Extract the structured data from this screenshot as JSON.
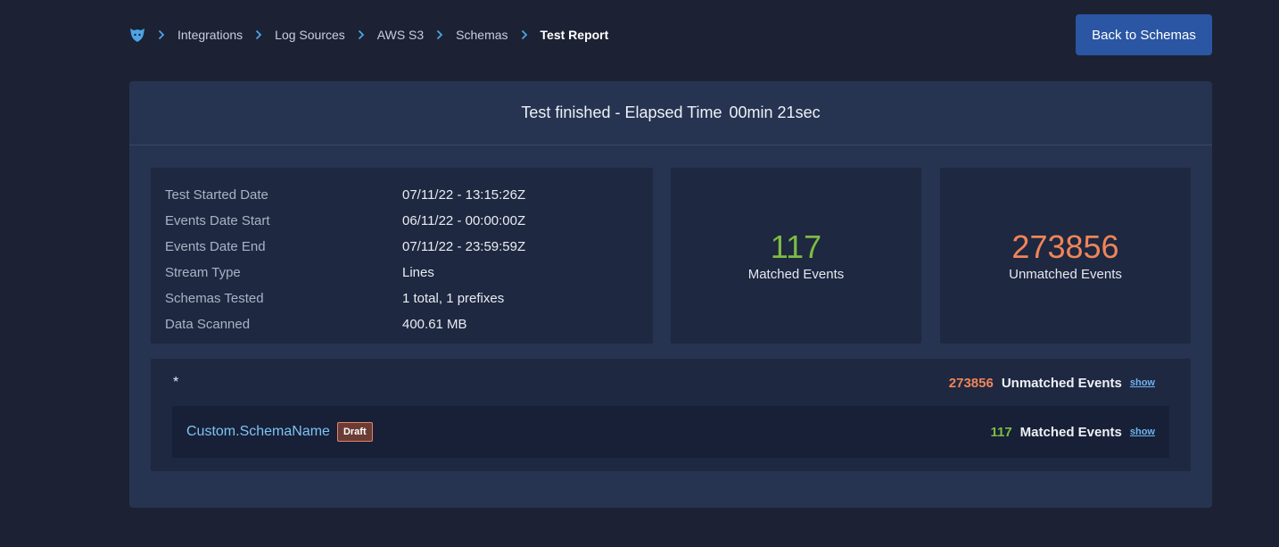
{
  "breadcrumb": {
    "logo_icon": "panther-logo-icon",
    "items": [
      "Integrations",
      "Log Sources",
      "AWS S3",
      "Schemas"
    ],
    "current": "Test Report"
  },
  "header": {
    "back_button_label": "Back to Schemas"
  },
  "report": {
    "status_text": "Test finished - Elapsed Time",
    "elapsed": "00min 21sec",
    "details": [
      {
        "label": "Test Started Date",
        "value": "07/11/22 - 13:15:26Z"
      },
      {
        "label": "Events Date Start",
        "value": "06/11/22 - 00:00:00Z"
      },
      {
        "label": "Events Date End",
        "value": "07/11/22 - 23:59:59Z"
      },
      {
        "label": "Stream Type",
        "value": "Lines"
      },
      {
        "label": "Schemas Tested",
        "value": "1 total, 1 prefixes"
      },
      {
        "label": "Data Scanned",
        "value": "400.61 MB"
      }
    ],
    "matched": {
      "count": "117",
      "label": "Matched Events"
    },
    "unmatched": {
      "count": "273856",
      "label": "Unmatched Events"
    }
  },
  "prefix": {
    "name": "*",
    "unmatched_count": "273856",
    "unmatched_label": "Unmatched Events",
    "show_label": "show",
    "schema": {
      "name": "Custom.SchemaName",
      "badge": "Draft",
      "matched_count": "117",
      "matched_label": "Matched Events",
      "show_label": "show"
    }
  },
  "colors": {
    "matched": "#7dbb42",
    "unmatched": "#f08559",
    "accent": "#2a56a3",
    "link": "#6fb3ef"
  }
}
